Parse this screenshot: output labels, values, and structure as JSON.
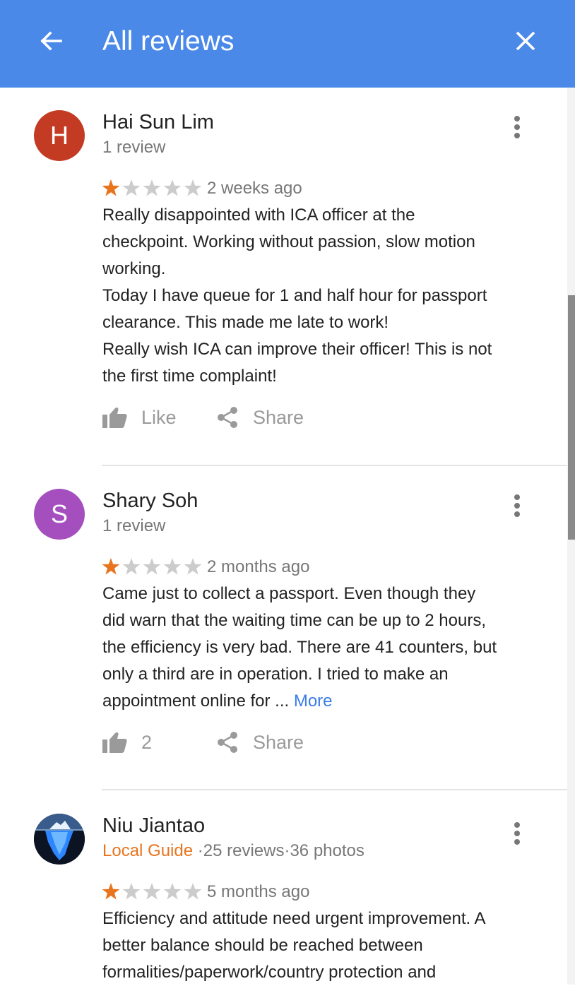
{
  "header": {
    "title": "All reviews",
    "back_icon": "arrow-left-icon",
    "close_icon": "close-icon",
    "background_color": "#4a89e8"
  },
  "reviews": [
    {
      "avatar_letter": "H",
      "avatar_color": "#c23b22",
      "name": "Hai Sun Lim",
      "meta": "1 review",
      "rating": 1,
      "max_rating": 5,
      "date": "2 weeks ago",
      "text_lines": [
        "Really disappointed with ICA officer at the",
        "checkpoint. Working without passion, slow motion",
        "working.",
        "Today I have queue for 1 and half hour for passport",
        "clearance. This made me late to work!",
        "Really wish ICA can improve their officer! This is not",
        "the first time complaint!"
      ],
      "like_label": "Like",
      "share_label": "Share"
    },
    {
      "avatar_letter": "S",
      "avatar_color": "#a54fbf",
      "name": "Shary Soh",
      "meta": "1 review",
      "rating": 1,
      "max_rating": 5,
      "date": "2 months ago",
      "text_lines": [
        "Came just to collect a passport. Even though they",
        "did warn that the waiting time can be up to 2 hours,",
        "the efficiency is very bad. There are 41 counters, but",
        "only a third are in operation. I tried to make an"
      ],
      "last_line": "appointment online for ... ",
      "more_label": "More",
      "like_label": "2",
      "share_label": "Share"
    },
    {
      "avatar_image": "iceberg-photo",
      "name": "Niu Jiantao",
      "guide_label": "Local Guide",
      "meta_rest": " ·25 reviews·36 photos",
      "rating": 1,
      "max_rating": 5,
      "date": "5 months ago",
      "text_lines": [
        "Efficiency and attitude need urgent improvement. A",
        "better balance should be reached between",
        "formalities/paperwork/country protection and"
      ]
    }
  ],
  "colors": {
    "star_filled": "#e8741e",
    "star_empty": "#cccccc",
    "link": "#3b7de3",
    "guide": "#e8741e"
  },
  "icons": {
    "like": "thumbs-up-icon",
    "share": "share-icon",
    "more": "more-vert-icon",
    "star": "star-icon"
  }
}
